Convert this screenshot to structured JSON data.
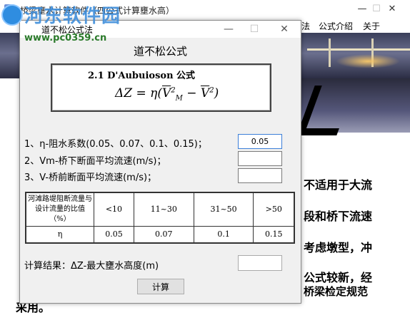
{
  "main_window": {
    "title": "桥梁壅水计算软件（四公式计算壅水高）",
    "menu": [
      "法",
      "公式介绍",
      "关于"
    ],
    "side_text": [
      "不适用于大流",
      "段和桥下流速",
      "考虑墩型，冲",
      "公式较新，经",
      "桥梁检定规范"
    ],
    "bottom_text": "采用。"
  },
  "watermark": {
    "title": "河东软件园",
    "url": "www.pc0359.cn"
  },
  "dialog": {
    "title": "道不松公式法",
    "heading": "道不松公式",
    "formula": {
      "title": "2.1  D'Aubuioson 公式",
      "lhs": "ΔZ = η(",
      "v_m": "V",
      "sub_m": "M",
      "sup2": "2",
      "minus": " − ",
      "v": "V",
      "rhs": ")"
    },
    "params": [
      {
        "label": "1、η-阻水系数(0.05、0.07、0.1、0.15)；",
        "value": "0.05"
      },
      {
        "label": "2、Vm-桥下断面平均流速(m/s)；",
        "value": ""
      },
      {
        "label": "3、V-桥前断面平均流速(m/s)；",
        "value": ""
      }
    ],
    "table": {
      "header_label": "河滩路堤阻断流量与设计流量的比值（%）",
      "header_cols": [
        "<10",
        "11~30",
        "31~50",
        ">50"
      ],
      "row_label": "η",
      "row_values": [
        "0.05",
        "0.07",
        "0.1",
        "0.15"
      ]
    },
    "result_label": "计算结果：ΔZ-最大壅水高度(m)",
    "result_value": "",
    "calc_button": "计算"
  },
  "controls": {
    "minimize": "—",
    "maximize": "☐",
    "close": "✕"
  }
}
